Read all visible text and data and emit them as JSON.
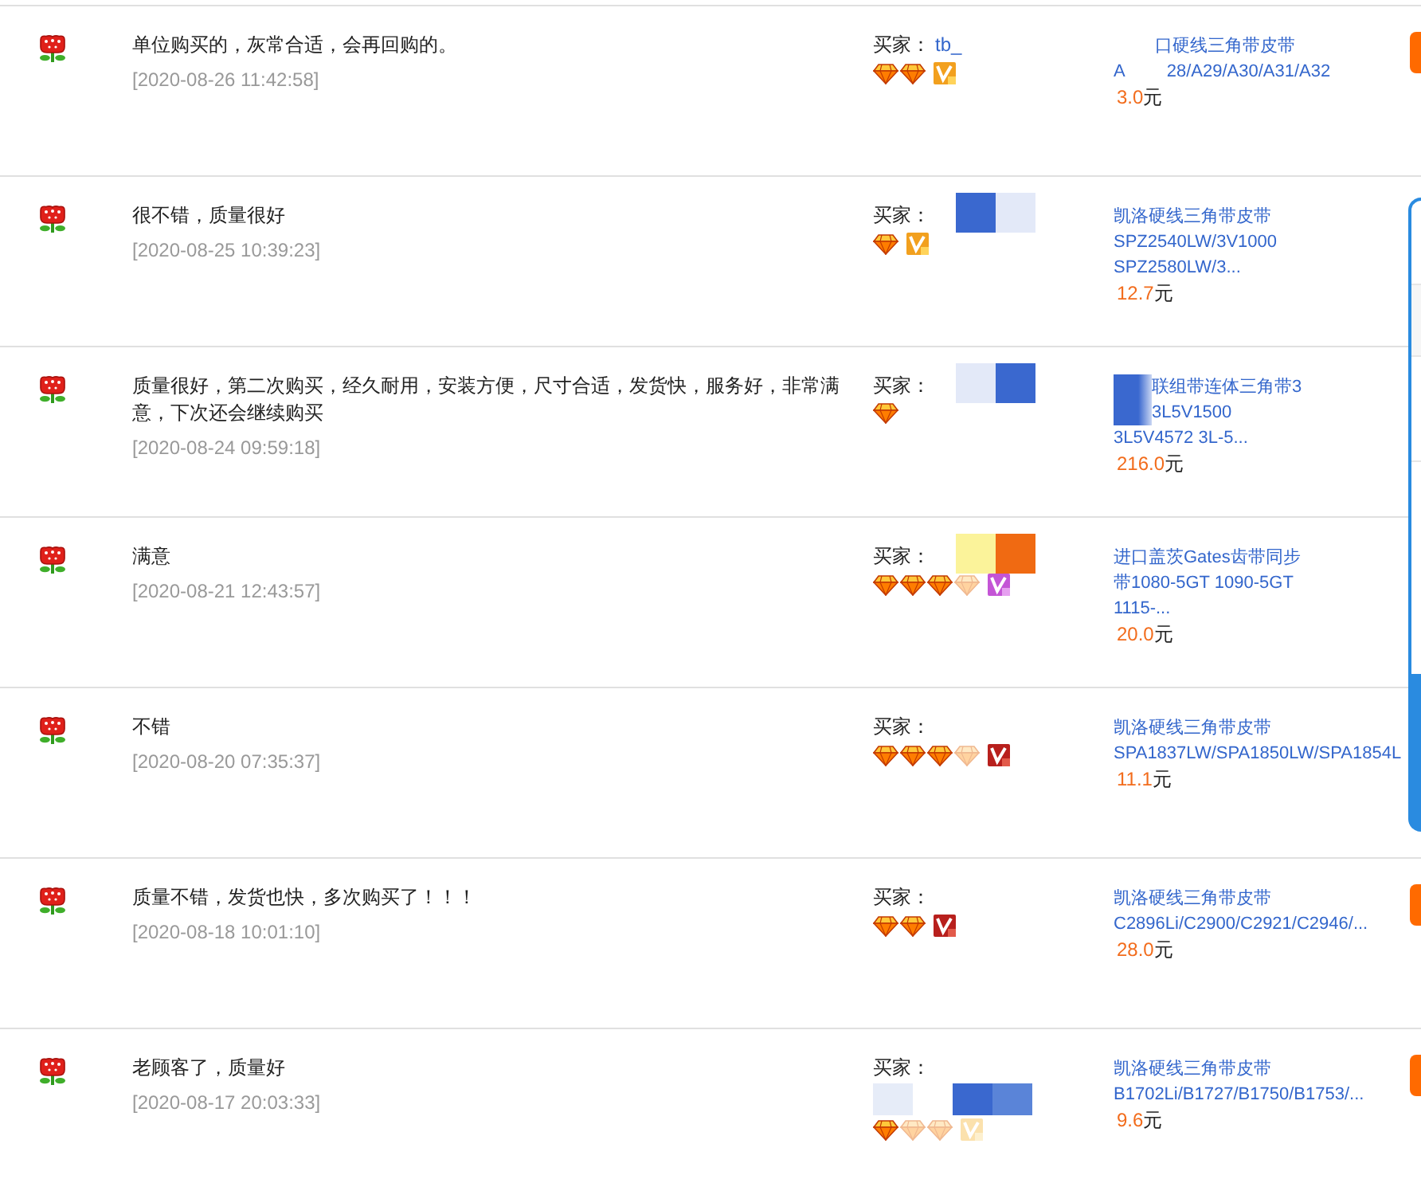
{
  "rows": [
    {
      "comment": "单位购买的，灰常合适，会再回购的。",
      "date": "[2020-08-26 11:42:58]",
      "buyer": {
        "label": "买家：",
        "name": "tb_",
        "diamonds": [
          {
            "faded": false
          },
          {
            "faded": false
          }
        ],
        "badge": {
          "kind": "gold",
          "faded": false
        }
      },
      "product": {
        "lines": [
          [
            {
              "kind": "gap"
            },
            {
              "kind": "text",
              "text": "口硬线三角带皮带"
            }
          ],
          [
            {
              "kind": "text",
              "text": "A"
            },
            {
              "kind": "gap"
            },
            {
              "kind": "text",
              "text": "28/A29/A30/A31/A32"
            }
          ]
        ],
        "price": "3.0",
        "unit": "元"
      },
      "action_button": true
    },
    {
      "comment": "很不错，质量很好",
      "date": "[2020-08-25 10:39:23]",
      "buyer": {
        "label": "买家：",
        "mask": {
          "kind": "inline",
          "blocks": [
            {
              "kind": "patch",
              "color": "#3a68cf"
            },
            {
              "kind": "patch",
              "color": "#e3e9f8"
            }
          ]
        },
        "diamonds": [
          {
            "faded": false
          }
        ],
        "badge": {
          "kind": "gold",
          "faded": false
        }
      },
      "product": {
        "lines": [
          [
            {
              "kind": "text",
              "text": "凯洛硬线三角带皮带"
            }
          ],
          [
            {
              "kind": "text",
              "text": "SPZ2540LW/3V1000"
            }
          ],
          [
            {
              "kind": "text",
              "text": "SPZ2580LW/3..."
            }
          ]
        ],
        "price": "12.7",
        "unit": "元"
      },
      "action_button": false
    },
    {
      "comment": "质量很好，第二次购买，经久耐用，安装方便，尺寸合适，发货快，服务好，非常满意，下次还会继续购买",
      "date": "[2020-08-24 09:59:18]",
      "buyer": {
        "label": "买家：",
        "mask": {
          "kind": "inline",
          "blocks": [
            {
              "kind": "patch",
              "color": "#e3e9f8"
            },
            {
              "kind": "patch",
              "color": "#3a68cf"
            }
          ]
        },
        "diamonds": [
          {
            "faded": false
          }
        ]
      },
      "product": {
        "lines": [
          [
            {
              "kind": "redaction"
            },
            {
              "kind": "text",
              "text": "联组带连体三角带3"
            }
          ],
          [
            {
              "kind": "redaction"
            },
            {
              "kind": "text",
              "text": "3L5V1500"
            }
          ],
          [
            {
              "kind": "text",
              "text": "3L5V4572 3L-5..."
            }
          ]
        ],
        "price": "216.0",
        "unit": "元"
      },
      "action_button": false
    },
    {
      "comment": "满意",
      "date": "[2020-08-21 12:43:57]",
      "buyer": {
        "label": "买家：",
        "mask": {
          "kind": "inline",
          "blocks": [
            {
              "kind": "patch",
              "color": "#fbf39a"
            },
            {
              "kind": "patch",
              "color": "#f06a12"
            }
          ]
        },
        "diamonds": [
          {
            "faded": false
          },
          {
            "faded": false
          },
          {
            "faded": false
          },
          {
            "faded": true
          }
        ],
        "badge": {
          "kind": "purple",
          "faded": false
        }
      },
      "product": {
        "lines": [
          [
            {
              "kind": "text",
              "text": "进口盖茨Gates齿带同步"
            }
          ],
          [
            {
              "kind": "text",
              "text": "带1080-5GT 1090-5GT"
            }
          ],
          [
            {
              "kind": "text",
              "text": "1115-..."
            }
          ]
        ],
        "price": "20.0",
        "unit": "元"
      },
      "action_button": false
    },
    {
      "comment": "不错",
      "date": "[2020-08-20 07:35:37]",
      "buyer": {
        "label": "买家：",
        "diamonds": [
          {
            "faded": false
          },
          {
            "faded": false
          },
          {
            "faded": false
          },
          {
            "faded": true
          }
        ],
        "badge": {
          "kind": "red",
          "faded": false
        }
      },
      "product": {
        "lines": [
          [
            {
              "kind": "text",
              "text": "凯洛硬线三角带皮带"
            }
          ],
          [
            {
              "kind": "text",
              "text": "SPA1837LW/SPA1850LW/SPA1854L"
            }
          ]
        ],
        "price": "11.1",
        "unit": "元"
      },
      "action_button": false
    },
    {
      "comment": "质量不错，发货也快，多次购买了！！！",
      "date": "[2020-08-18 10:01:10]",
      "buyer": {
        "label": "买家：",
        "diamonds": [
          {
            "faded": false
          },
          {
            "faded": false
          }
        ],
        "badge": {
          "kind": "red",
          "faded": false
        }
      },
      "product": {
        "lines": [
          [
            {
              "kind": "text",
              "text": "凯洛硬线三角带皮带"
            }
          ],
          [
            {
              "kind": "text",
              "text": "C2896Li/C2900/C2921/C2946/..."
            }
          ]
        ],
        "price": "28.0",
        "unit": "元"
      },
      "action_button": true
    },
    {
      "comment": "老顾客了，质量好",
      "date": "[2020-08-17 20:03:33]",
      "buyer": {
        "label": "买家：",
        "mask": {
          "kind": "block",
          "blocks": [
            {
              "kind": "patch",
              "color": "#e6ecf8"
            },
            {
              "kind": "gap"
            },
            {
              "kind": "patch",
              "color": "#3a68cf"
            },
            {
              "kind": "patch",
              "color": "#5a84d8"
            }
          ]
        },
        "diamonds": [
          {
            "faded": false
          },
          {
            "faded": true
          },
          {
            "faded": true
          }
        ],
        "badge": {
          "kind": "gold",
          "faded": true
        }
      },
      "product": {
        "lines": [
          [
            {
              "kind": "text",
              "text": "凯洛硬线三角带皮带"
            }
          ],
          [
            {
              "kind": "text",
              "text": "B1702Li/B1727/B1750/B1753/..."
            }
          ]
        ],
        "price": "9.6",
        "unit": "元"
      },
      "action_button": true
    }
  ]
}
